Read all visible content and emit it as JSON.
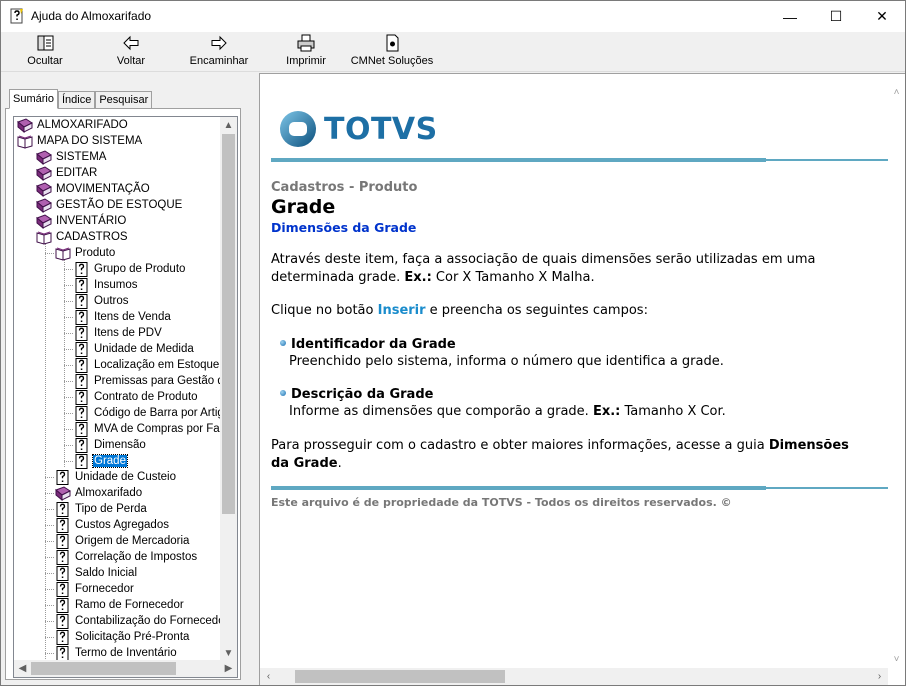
{
  "window": {
    "title": "Ajuda do Almoxarifado",
    "minimize_glyph": "—",
    "maximize_glyph": "☐",
    "close_glyph": "✕"
  },
  "toolbar": {
    "hide": "Ocultar",
    "back": "Voltar",
    "forward": "Encaminhar",
    "print": "Imprimir",
    "cmnet": "CMNet Soluções"
  },
  "tabs": {
    "contents": "Sumário",
    "index": "Índice",
    "search": "Pesquisar"
  },
  "tree": {
    "items": [
      {
        "label": "ALMOXARIFADO",
        "icon": "book-closed-icon",
        "level": 0
      },
      {
        "label": "MAPA DO SISTEMA",
        "icon": "book-open-icon",
        "level": 0
      },
      {
        "label": "SISTEMA",
        "icon": "book-closed-icon",
        "level": 1
      },
      {
        "label": "EDITAR",
        "icon": "book-closed-icon",
        "level": 1
      },
      {
        "label": "MOVIMENTAÇÃO",
        "icon": "book-closed-icon",
        "level": 1
      },
      {
        "label": "GESTÃO DE ESTOQUE",
        "icon": "book-closed-icon",
        "level": 1
      },
      {
        "label": "INVENTÁRIO",
        "icon": "book-closed-icon",
        "level": 1
      },
      {
        "label": "CADASTROS",
        "icon": "book-open-icon",
        "level": 1
      },
      {
        "label": "Produto",
        "icon": "book-open-icon",
        "level": 2
      },
      {
        "label": "Grupo de Produto",
        "icon": "help-page-icon",
        "level": 3
      },
      {
        "label": "Insumos",
        "icon": "help-page-icon",
        "level": 3
      },
      {
        "label": "Outros",
        "icon": "help-page-icon",
        "level": 3
      },
      {
        "label": "Itens de Venda",
        "icon": "help-page-icon",
        "level": 3
      },
      {
        "label": "Itens de PDV",
        "icon": "help-page-icon",
        "level": 3
      },
      {
        "label": "Unidade de Medida",
        "icon": "help-page-icon",
        "level": 3
      },
      {
        "label": "Localização em Estoque",
        "icon": "help-page-icon",
        "level": 3
      },
      {
        "label": "Premissas para Gestão de",
        "icon": "help-page-icon",
        "level": 3
      },
      {
        "label": "Contrato de Produto",
        "icon": "help-page-icon",
        "level": 3
      },
      {
        "label": "Código de Barra por Artigo",
        "icon": "help-page-icon",
        "level": 3
      },
      {
        "label": "MVA de Compras por Faix",
        "icon": "help-page-icon",
        "level": 3
      },
      {
        "label": "Dimensão",
        "icon": "help-page-icon",
        "level": 3
      },
      {
        "label": "Grade",
        "icon": "help-page-icon",
        "level": 3,
        "selected": true
      },
      {
        "label": "Unidade de Custeio",
        "icon": "help-page-icon",
        "level": 2
      },
      {
        "label": "Almoxarifado",
        "icon": "book-closed-icon",
        "level": 2
      },
      {
        "label": "Tipo de Perda",
        "icon": "help-page-icon",
        "level": 2
      },
      {
        "label": "Custos Agregados",
        "icon": "help-page-icon",
        "level": 2
      },
      {
        "label": "Origem de Mercadoria",
        "icon": "help-page-icon",
        "level": 2
      },
      {
        "label": "Correlação de Impostos",
        "icon": "help-page-icon",
        "level": 2
      },
      {
        "label": "Saldo Inicial",
        "icon": "help-page-icon",
        "level": 2
      },
      {
        "label": "Fornecedor",
        "icon": "help-page-icon",
        "level": 2
      },
      {
        "label": "Ramo de Fornecedor",
        "icon": "help-page-icon",
        "level": 2
      },
      {
        "label": "Contabilização do Fornecedor",
        "icon": "help-page-icon",
        "level": 2
      },
      {
        "label": "Solicitação Pré-Pronta",
        "icon": "help-page-icon",
        "level": 2
      },
      {
        "label": "Termo de Inventário",
        "icon": "help-page-icon",
        "level": 2
      }
    ]
  },
  "topic": {
    "logo": "TOTVS",
    "breadcrumb": "Cadastros - Produto",
    "title": "Grade",
    "subtitle_link": "Dimensões da Grade",
    "p1_a": "Através deste item, faça a associação de quais dimensões serão utilizadas em uma determinada grade. ",
    "p1_ex": "Ex.:",
    "p1_b": " Cor X Tamanho X Malha.",
    "p2_a": "Clique no botão ",
    "p2_link": "Inserir",
    "p2_b": " e preencha os seguintes campos:",
    "f1_title": "Identificador da Grade",
    "f1_desc": "Preenchido pelo sistema, informa o número que identifica a grade.",
    "f2_title": "Descrição da Grade",
    "f2_desc_a": "Informe as dimensões que comporão a grade. ",
    "f2_ex": "Ex.:",
    "f2_desc_b": " Tamanho X Cor.",
    "p3_a": "Para prosseguir com o cadastro e obter maiores informações, acesse a guia ",
    "p3_bold": "Dimensões da Grade",
    "p3_b": ".",
    "footer": "Este arquivo é de propriedade da TOTVS - Todos os direitos reservados. ©"
  },
  "colors": {
    "accent_line": "#5fa8c2",
    "link": "#1a8ccc",
    "subtitle": "#0033cc",
    "logo": "#1d6fa5",
    "selection": "#0078d7"
  }
}
